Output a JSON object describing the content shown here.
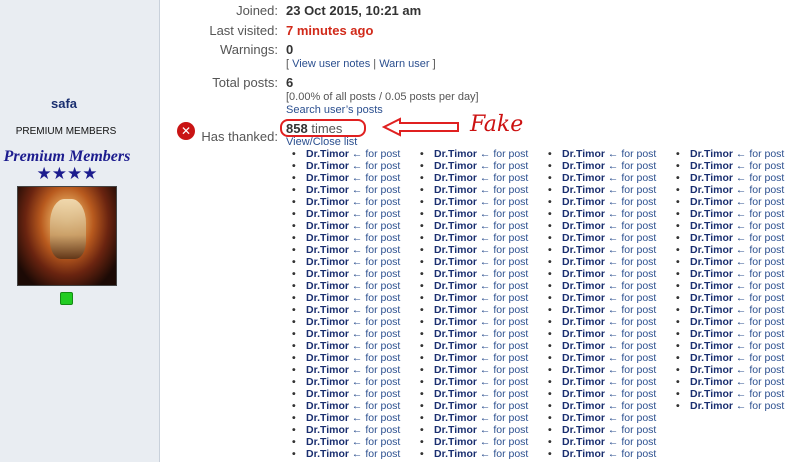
{
  "profile": {
    "username": "safa",
    "rank_small": "PREMIUM MEMBERS",
    "rank_title": "Premium Members",
    "rank_stars": "★★★★",
    "joined_label": "Joined:",
    "joined_value": "23 Oct 2015, 10:21 am",
    "last_visited_label": "Last visited:",
    "last_visited_value": "7 minutes ago",
    "warnings_label": "Warnings:",
    "warnings_value": "0",
    "view_notes": "View user notes",
    "warn_user": "Warn user",
    "total_posts_label": "Total posts:",
    "total_posts_value": "6",
    "posts_stats": "[0.00% of all posts / 0.05 posts per day]",
    "search_posts": "Search user’s posts",
    "has_thanked_label": "Has thanked:",
    "thanked_count": "858",
    "thanked_unit": "times",
    "view_close": "View/Close list"
  },
  "annotation": {
    "fake_label": "Fake",
    "color": "#e02020"
  },
  "thank_list": {
    "user": "Dr.Timor",
    "suffix": "← for post",
    "column_counts": [
      26,
      26,
      26,
      22
    ]
  }
}
